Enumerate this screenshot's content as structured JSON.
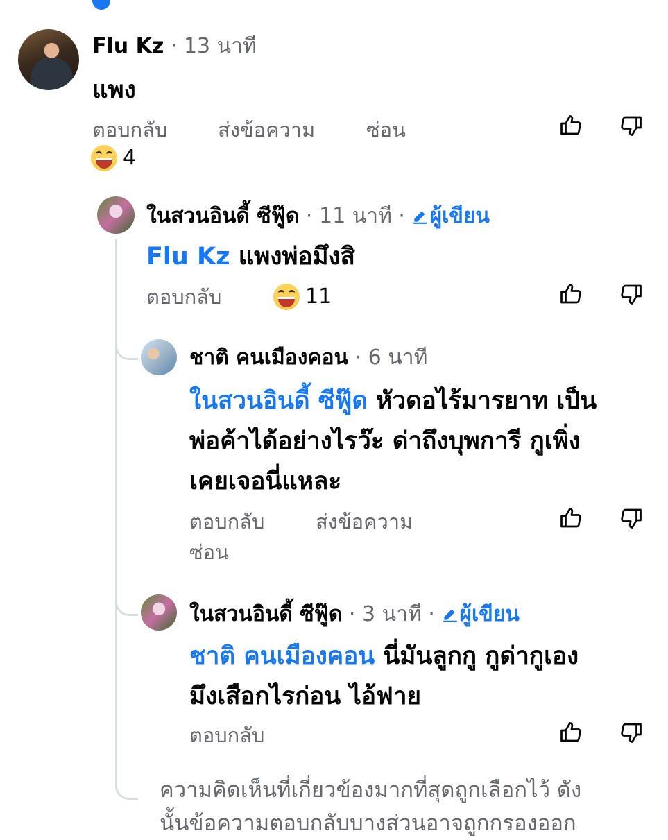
{
  "comments": [
    {
      "author": "Flu Kz",
      "time": "13 นาที",
      "text": "แพง",
      "actions": [
        "ตอบกลับ",
        "ส่งข้อความ",
        "ซ่อน"
      ],
      "reaction_count": "4"
    },
    {
      "author": "ในสวนอินดี้ ซีฟู๊ด",
      "time": "11 นาที",
      "author_badge": "ผู้เขียน",
      "mention": "Flu Kz",
      "text": "แพงพ่อมึงสิ",
      "actions": [
        "ตอบกลับ"
      ],
      "reaction_count": "11"
    },
    {
      "author": "ชาติ คนเมืองคอน",
      "time": "6 นาที",
      "mention": "ในสวนอินดี้ ซีฟู๊ด",
      "text_line1": "หัวดอไร้มารยาท เป็น",
      "text_line2": "พ่อค้าได้อย่างไรว๊ะ ด่าถึงบุพการี กูเพิ่ง",
      "text_line3": "เคยเจอนี่แหละ",
      "actions": [
        "ตอบกลับ",
        "ส่งข้อความ",
        "ซ่อน"
      ]
    },
    {
      "author": "ในสวนอินดี้ ซีฟู๊ด",
      "time": "3 นาที",
      "author_badge": "ผู้เขียน",
      "mention": "ชาติ คนเมืองคอน",
      "text_line1": "นี่มันลูกกู กูด่ากูเอง",
      "text_line2": "มึงเสือกไรก่อน ไอ้ฟาย",
      "actions": [
        "ตอบกลับ"
      ]
    }
  ],
  "separator": "·",
  "footer_note_line1": "ความคิดเห็นที่เกี่ยวข้องมากที่สุดถูกเลือกไว้ ดัง",
  "footer_note_line2": "นั้นข้อความตอบกลับบางส่วนอาจถูกกรองออก",
  "colors": {
    "link": "#1877f2",
    "muted": "#65676b",
    "text": "#050505",
    "thread_line": "#dadde1"
  },
  "icons": [
    "thumbs-up-icon",
    "thumbs-down-icon",
    "grinning-emoji-icon",
    "pencil-icon"
  ]
}
